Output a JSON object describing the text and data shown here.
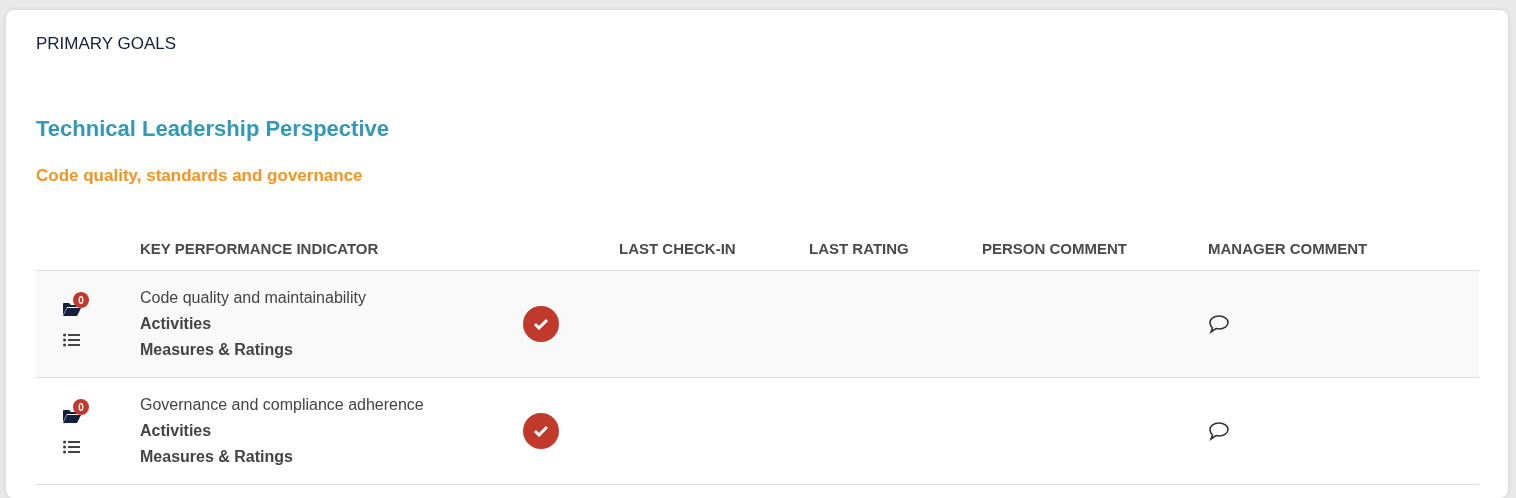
{
  "section_title": "PRIMARY GOALS",
  "perspective": "Technical Leadership Perspective",
  "objective": "Code quality, standards and governance",
  "table": {
    "columns": [
      "KEY PERFORMANCE INDICATOR",
      "LAST CHECK-IN",
      "LAST RATING",
      "PERSON COMMENT",
      "MANAGER COMMENT"
    ],
    "rows": [
      {
        "attachments": "0",
        "kpi": "Code quality and maintainability",
        "links": [
          "Activities",
          "Measures & Ratings"
        ],
        "checked": true
      },
      {
        "attachments": "0",
        "kpi": "Governance and compliance adherence",
        "links": [
          "Activities",
          "Measures & Ratings"
        ],
        "checked": true
      }
    ]
  }
}
